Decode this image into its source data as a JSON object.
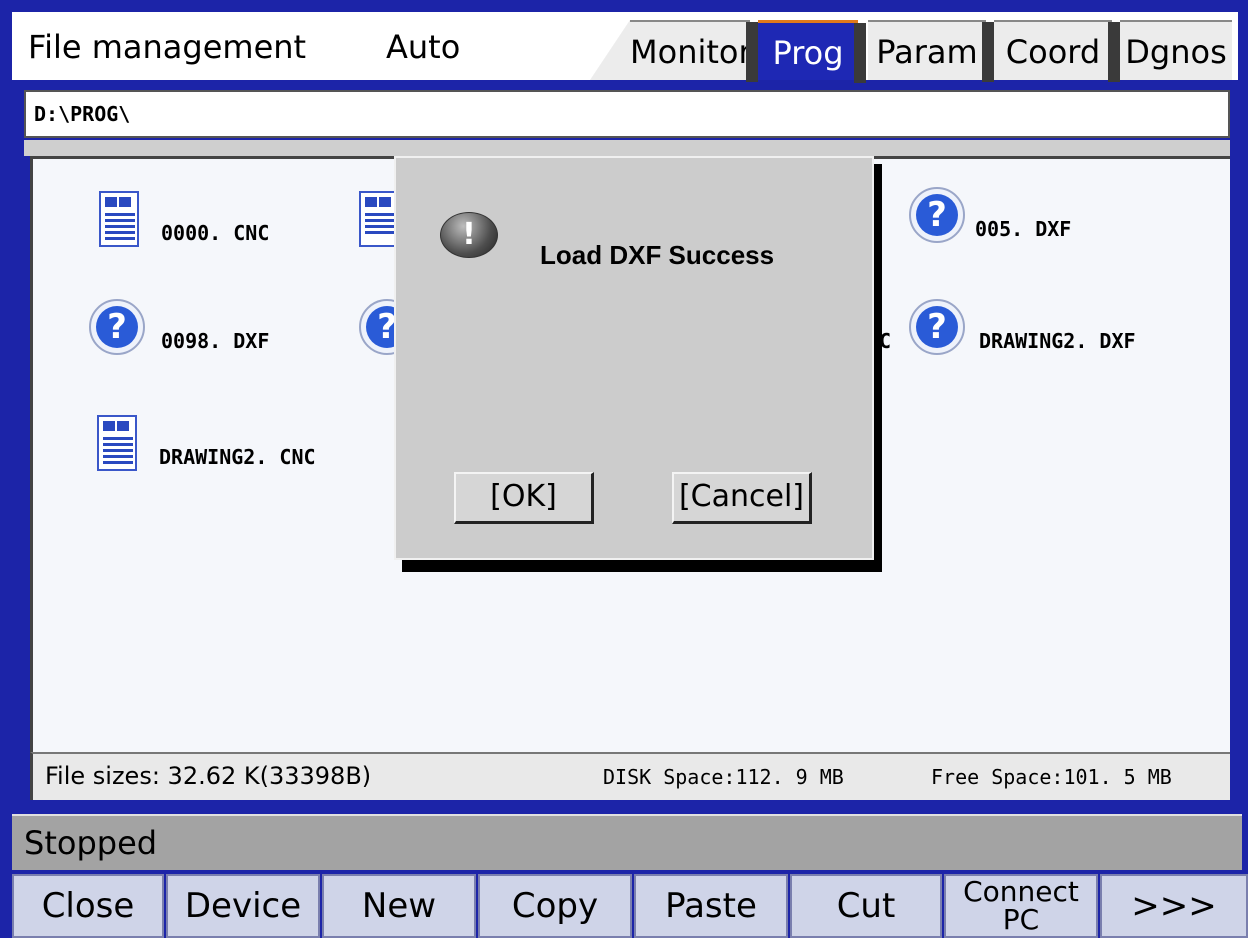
{
  "header": {
    "mode_title": "File management",
    "run_mode": "Auto",
    "tabs": [
      {
        "label": "Monitor",
        "active": false
      },
      {
        "label": "Prog",
        "active": true
      },
      {
        "label": "Param",
        "active": false
      },
      {
        "label": "Coord",
        "active": false
      },
      {
        "label": "Dgnos",
        "active": false
      }
    ]
  },
  "path": "D:\\PROG\\",
  "files": [
    {
      "name": "0000. CNC",
      "icon": "cnc-document-icon"
    },
    {
      "name": "005. DXF",
      "icon": "dxf-unknown-icon"
    },
    {
      "name": "0098. DXF",
      "icon": "dxf-unknown-icon"
    },
    {
      "name": "DRAWING2. DXF",
      "icon": "dxf-unknown-icon"
    },
    {
      "name": "DRAWING2. CNC",
      "icon": "cnc-document-icon"
    },
    {
      "name": "C",
      "icon": "partial"
    }
  ],
  "info": {
    "file_sizes": "File sizes: 32.62 K(33398B)",
    "disk_space": "DISK Space:112. 9 MB",
    "free_space": "Free Space:101. 5 MB"
  },
  "status": "Stopped",
  "softkeys": [
    "Close",
    "Device",
    "New",
    "Copy",
    "Paste",
    "Cut",
    "Connect PC",
    ">>>"
  ],
  "softkey_connect_line1": "Connect",
  "softkey_connect_line2": "PC",
  "dialog": {
    "icon": "exclamation-icon",
    "message": "Load DXF Success",
    "ok_label": "[OK]",
    "cancel_label": "[Cancel]"
  },
  "colors": {
    "frame_blue": "#1c24a8",
    "active_tab": "#1e28b4",
    "status_gray": "#a3a3a3",
    "softkey_bg": "#cfd4e8"
  }
}
